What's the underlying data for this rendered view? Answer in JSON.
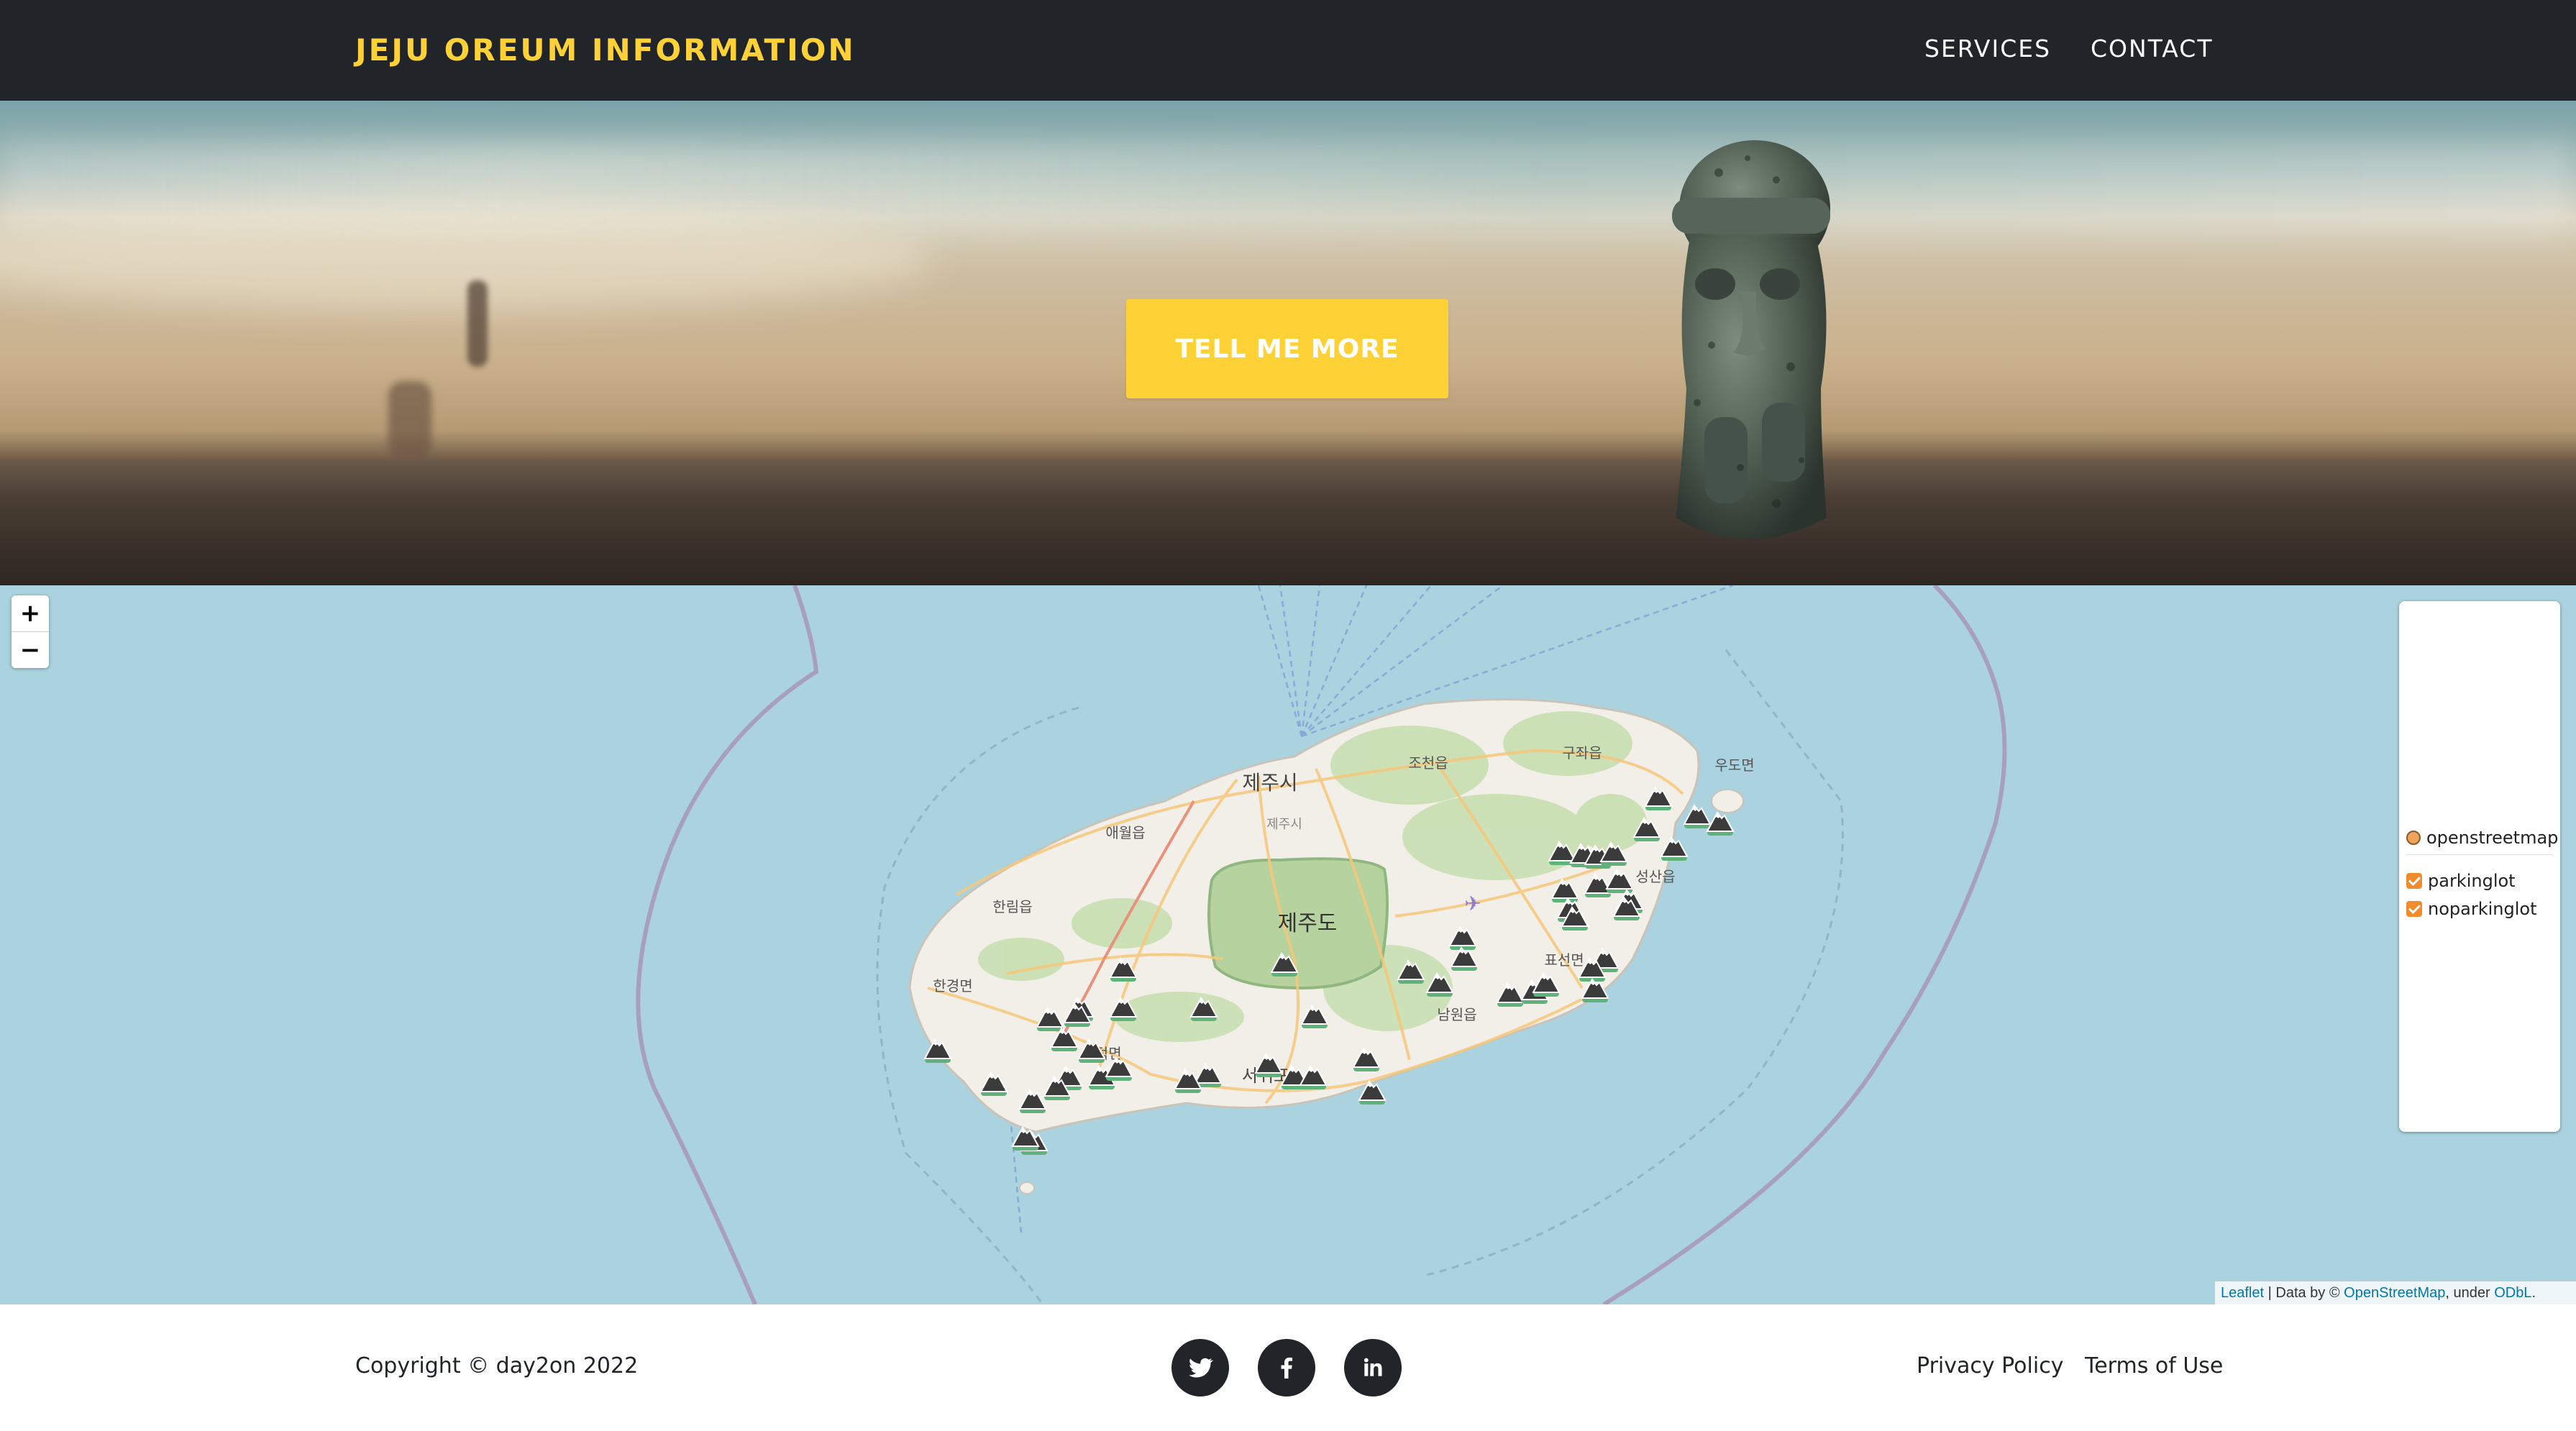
{
  "navbar": {
    "brand": "JEJU OREUM INFORMATION",
    "links": [
      "SERVICES",
      "CONTACT"
    ]
  },
  "hero": {
    "cta_label": "TELL ME MORE"
  },
  "map": {
    "zoom_in": "+",
    "zoom_out": "−",
    "labels": {
      "jeju_si": "제주시",
      "jeju_si_small": "제주시",
      "jeju_do": "제주도",
      "jocheon": "조천읍",
      "gujwa": "구좌읍",
      "udo": "우도면",
      "aewol": "애월읍",
      "hallim": "한림읍",
      "hangyeong": "한경면",
      "seongsan": "성산읍",
      "pyoseon": "표선면",
      "namwon": "남원읍",
      "andeok": "안덕면",
      "seogwipo": "서귀포"
    },
    "layers": {
      "base": "openstreetmap",
      "overlays": [
        "parkinglot",
        "noparkinglot"
      ]
    },
    "attribution": {
      "leaflet": "Leaflet",
      "sep": " | Data by © ",
      "osm": "OpenStreetMap",
      "under": ", under ",
      "odbl": "ODbL",
      "end": "."
    },
    "colors": {
      "sea": "#aad3df",
      "land": "#f2efe9",
      "park": "#b5d29f",
      "marker_body": "#3b3b3b",
      "marker_base": "#5fb37a"
    }
  },
  "footer": {
    "copyright": "Copyright © day2on 2022",
    "social_icons": [
      "twitter-icon",
      "facebook-icon",
      "linkedin-icon"
    ],
    "links": [
      "Privacy Policy",
      "Terms of Use"
    ]
  },
  "theme": {
    "accent": "#fed136",
    "dark": "#212529"
  }
}
